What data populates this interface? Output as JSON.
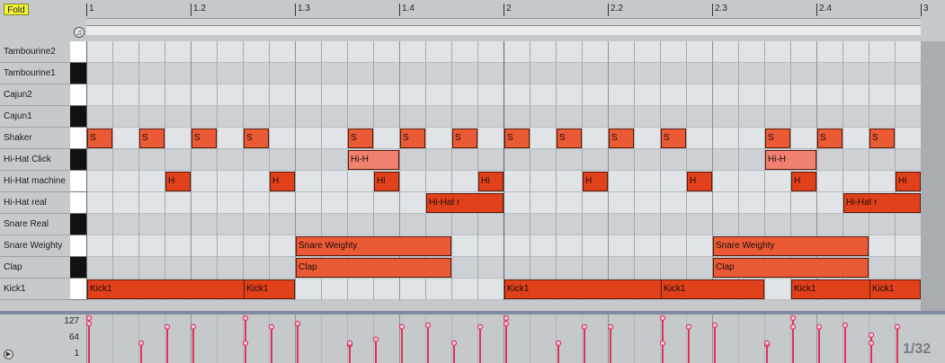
{
  "fold_button": "Fold",
  "grid_resolution": "1/32",
  "ruler": {
    "ticks": [
      "1",
      "1.2",
      "1.3",
      "1.4",
      "2",
      "2.2",
      "2.3",
      "2.4",
      "3"
    ]
  },
  "lanes": [
    {
      "label": "Tambourine2",
      "key": "white"
    },
    {
      "label": "Tambourine1",
      "key": "black"
    },
    {
      "label": "Cajun2",
      "key": "white"
    },
    {
      "label": "Cajun1",
      "key": "black"
    },
    {
      "label": "Shaker",
      "key": "white"
    },
    {
      "label": "Hi-Hat Click",
      "key": "black"
    },
    {
      "label": "Hi-Hat machine",
      "key": "white"
    },
    {
      "label": "Hi-Hat real",
      "key": "white"
    },
    {
      "label": "Snare Real",
      "key": "black"
    },
    {
      "label": "Snare Weighty",
      "key": "white"
    },
    {
      "label": "Clap",
      "key": "black"
    },
    {
      "label": "Kick1",
      "key": "white"
    }
  ],
  "notes": [
    {
      "lane": 4,
      "start": 0,
      "len": 1,
      "text": "S"
    },
    {
      "lane": 4,
      "start": 2,
      "len": 1,
      "text": "S"
    },
    {
      "lane": 4,
      "start": 4,
      "len": 1,
      "text": "S"
    },
    {
      "lane": 4,
      "start": 6,
      "len": 1,
      "text": "S"
    },
    {
      "lane": 4,
      "start": 10,
      "len": 1,
      "text": "S"
    },
    {
      "lane": 4,
      "start": 12,
      "len": 1,
      "text": "S"
    },
    {
      "lane": 4,
      "start": 14,
      "len": 1,
      "text": "S"
    },
    {
      "lane": 4,
      "start": 16,
      "len": 1,
      "text": "S"
    },
    {
      "lane": 4,
      "start": 18,
      "len": 1,
      "text": "S"
    },
    {
      "lane": 4,
      "start": 20,
      "len": 1,
      "text": "S"
    },
    {
      "lane": 4,
      "start": 22,
      "len": 1,
      "text": "S"
    },
    {
      "lane": 4,
      "start": 26,
      "len": 1,
      "text": "S"
    },
    {
      "lane": 4,
      "start": 28,
      "len": 1,
      "text": "S"
    },
    {
      "lane": 4,
      "start": 30,
      "len": 1,
      "text": "S"
    },
    {
      "lane": 5,
      "start": 10,
      "len": 2,
      "text": "Hi-H"
    },
    {
      "lane": 5,
      "start": 26,
      "len": 2,
      "text": "Hi-H"
    },
    {
      "lane": 6,
      "start": 3,
      "len": 1,
      "text": "H"
    },
    {
      "lane": 6,
      "start": 7,
      "len": 1,
      "text": "H"
    },
    {
      "lane": 6,
      "start": 11,
      "len": 1,
      "text": "Hi"
    },
    {
      "lane": 6,
      "start": 15,
      "len": 1,
      "text": "Hi"
    },
    {
      "lane": 6,
      "start": 19,
      "len": 1,
      "text": "H"
    },
    {
      "lane": 6,
      "start": 23,
      "len": 1,
      "text": "H"
    },
    {
      "lane": 6,
      "start": 27,
      "len": 1,
      "text": "H"
    },
    {
      "lane": 6,
      "start": 31,
      "len": 1,
      "text": "Hi"
    },
    {
      "lane": 7,
      "start": 13,
      "len": 3,
      "text": "Hi-Hat r"
    },
    {
      "lane": 7,
      "start": 29,
      "len": 3,
      "text": "Hi-Hat r"
    },
    {
      "lane": 9,
      "start": 8,
      "len": 6,
      "text": "Snare Weighty"
    },
    {
      "lane": 9,
      "start": 24,
      "len": 6,
      "text": "Snare Weighty"
    },
    {
      "lane": 10,
      "start": 8,
      "len": 6,
      "text": "Clap"
    },
    {
      "lane": 10,
      "start": 24,
      "len": 6,
      "text": "Clap"
    },
    {
      "lane": 11,
      "start": 0,
      "len": 8,
      "text": "Kick1"
    },
    {
      "lane": 11,
      "start": 6,
      "len": 2,
      "text": "Kick1"
    },
    {
      "lane": 11,
      "start": 16,
      "len": 8,
      "text": "Kick1"
    },
    {
      "lane": 11,
      "start": 22,
      "len": 4,
      "text": "Kick1"
    },
    {
      "lane": 11,
      "start": 27,
      "len": 4,
      "text": "Kick1"
    },
    {
      "lane": 11,
      "start": 30,
      "len": 4,
      "text": "Kick1"
    }
  ],
  "velocity_axis": [
    "127",
    "64",
    "1"
  ],
  "velocities": [
    {
      "step": 0,
      "v": 127
    },
    {
      "step": 0,
      "v": 110
    },
    {
      "step": 2,
      "v": 50
    },
    {
      "step": 3,
      "v": 100
    },
    {
      "step": 4,
      "v": 100
    },
    {
      "step": 6,
      "v": 127
    },
    {
      "step": 6,
      "v": 50
    },
    {
      "step": 7,
      "v": 100
    },
    {
      "step": 8,
      "v": 110
    },
    {
      "step": 10,
      "v": 45
    },
    {
      "step": 10,
      "v": 50
    },
    {
      "step": 11,
      "v": 62
    },
    {
      "step": 12,
      "v": 100
    },
    {
      "step": 13,
      "v": 105
    },
    {
      "step": 14,
      "v": 50
    },
    {
      "step": 15,
      "v": 100
    },
    {
      "step": 16,
      "v": 127
    },
    {
      "step": 16,
      "v": 110
    },
    {
      "step": 18,
      "v": 50
    },
    {
      "step": 19,
      "v": 100
    },
    {
      "step": 20,
      "v": 100
    },
    {
      "step": 22,
      "v": 127
    },
    {
      "step": 22,
      "v": 50
    },
    {
      "step": 23,
      "v": 100
    },
    {
      "step": 24,
      "v": 105
    },
    {
      "step": 26,
      "v": 45
    },
    {
      "step": 26,
      "v": 50
    },
    {
      "step": 27,
      "v": 127
    },
    {
      "step": 27,
      "v": 100
    },
    {
      "step": 28,
      "v": 100
    },
    {
      "step": 29,
      "v": 105
    },
    {
      "step": 30,
      "v": 75
    },
    {
      "step": 30,
      "v": 50
    },
    {
      "step": 31,
      "v": 100
    }
  ],
  "colors": {
    "note_dark": "#e0401a",
    "note_mid": "#ea5a35",
    "note_light": "#f08070",
    "velocity": "#e03060"
  }
}
